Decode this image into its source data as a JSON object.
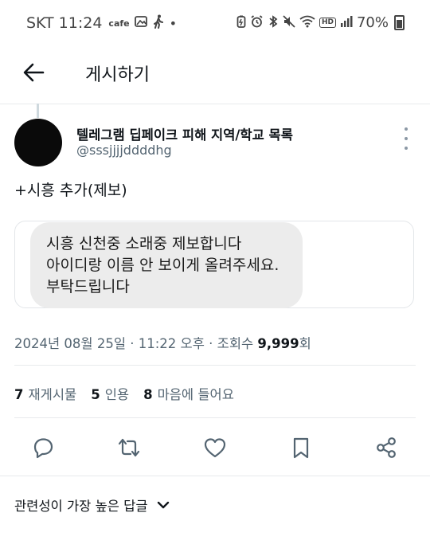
{
  "status_bar": {
    "carrier": "SKT",
    "time": "11:24",
    "cafe_label": "cafe",
    "battery": "70%",
    "hd_label": "HD"
  },
  "header": {
    "title": "게시하기",
    "back_icon": "arrow-left-icon"
  },
  "post": {
    "author_name": "텔레그램 딥페이크 피해 지역/학교 목록",
    "handle": "@sssjjjjddddhg",
    "text": "+시흥 추가(제보)",
    "message_lines": [
      "시흥 신천중 소래중 제보합니다",
      "아이디랑 이름 안 보이게 올려주세요.",
      "부탁드립니다"
    ],
    "date": "2024년 08월 25일 · 11:22 오후 · 조회수 ",
    "views": "9,999",
    "views_suffix": "회"
  },
  "stats": {
    "reposts_count": "7",
    "reposts_label": "재게시물",
    "quotes_count": "5",
    "quotes_label": "인용",
    "likes_count": "8",
    "likes_label": "마음에 들어요"
  },
  "actions": [
    "reply-icon",
    "repost-icon",
    "like-icon",
    "bookmark-icon",
    "share-icon"
  ],
  "replies_sort": {
    "label": "관련성이 가장 높은 답글"
  },
  "colors": {
    "text": "#0f1419",
    "secondary": "#536471",
    "icon": "#536471"
  }
}
